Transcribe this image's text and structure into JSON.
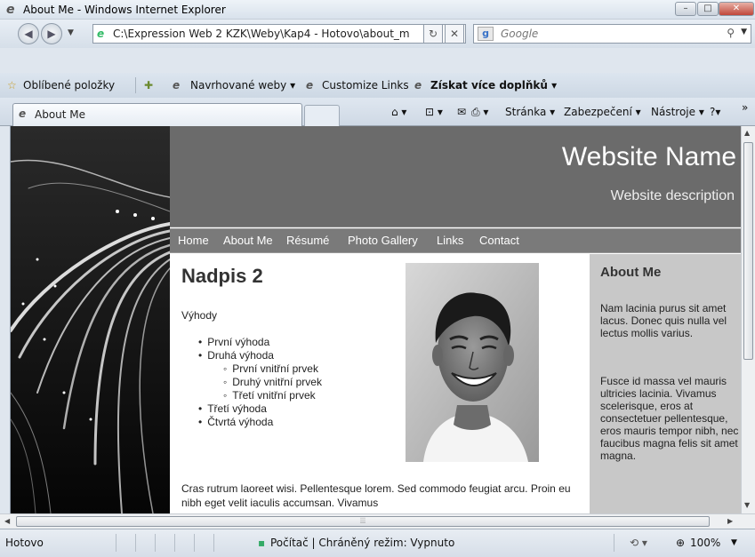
{
  "window": {
    "title": "About Me - Windows Internet Explorer",
    "buttons": [
      "–",
      "□",
      "✕"
    ]
  },
  "address_bar": {
    "url": "C:\\Expression Web 2 KZK\\Weby\\Kap4 - Hotovo\\about_m",
    "refresh": "↻",
    "stop": "✕",
    "search_placeholder": "Google"
  },
  "favorites_bar": {
    "favorites": "Oblíbené položky",
    "suggested": "Navrhované weby ▾",
    "customize": "Customize Links",
    "addons": "Získat více doplňků ▾"
  },
  "tab": {
    "label": "About Me"
  },
  "commands": {
    "page": "Stránka ▾",
    "safety": "Zabezpečení ▾",
    "tools": "Nástroje ▾",
    "more": "»"
  },
  "site": {
    "name": "Website Name",
    "description": "Website description",
    "nav": [
      "Home",
      "About Me",
      "Résumé",
      "Photo Gallery",
      "Links",
      "Contact"
    ],
    "heading": "Nadpis 2",
    "intro": "Výhody",
    "list": [
      {
        "text": "První výhoda",
        "level": 1
      },
      {
        "text": "Druhá výhoda",
        "level": 1
      },
      {
        "text": "První vnitřní prvek",
        "level": 2
      },
      {
        "text": "Druhý vnitřní prvek",
        "level": 2
      },
      {
        "text": "Třetí vnitřní prvek",
        "level": 2
      },
      {
        "text": "Třetí výhoda",
        "level": 1
      },
      {
        "text": "Čtvrtá výhoda",
        "level": 1
      }
    ],
    "paragraph": "Cras rutrum laoreet wisi. Pellentesque lorem. Sed commodo feugiat arcu. Proin eu nibh eget velit iaculis accumsan. Vivamus",
    "sidebar": {
      "title": "About Me",
      "p1": "Nam lacinia purus sit amet lacus. Donec quis nulla vel lectus mollis varius.",
      "p2": "Fusce id massa vel mauris ultricies lacinia. Vivamus scelerisque, eros at consectetuer pellentesque, eros mauris tempor nibh, nec faucibus magna felis sit amet magna."
    }
  },
  "status_bar": {
    "left": "Hotovo",
    "zone": "Počítač | Chráněný režim: Vypnuto",
    "zoom": "100%"
  }
}
